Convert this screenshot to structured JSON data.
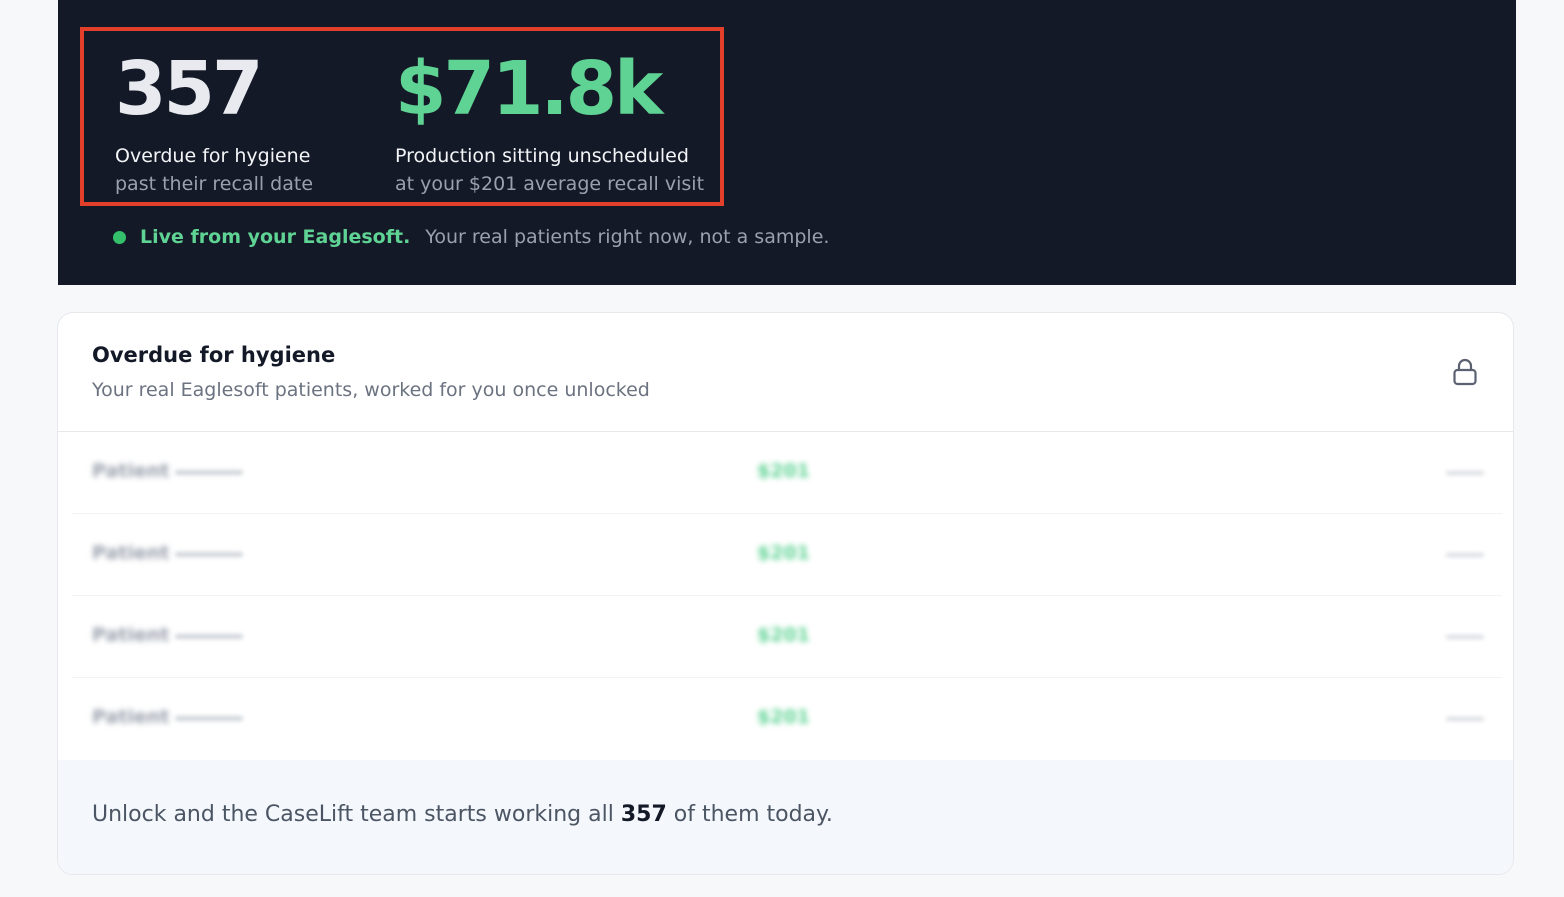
{
  "hero": {
    "stat1": {
      "value": "357",
      "label": "Overdue for hygiene",
      "sub": "past their recall date"
    },
    "stat2": {
      "value": "$71.8k",
      "label": "Production sitting unscheduled",
      "sub": "at your $201 average recall visit"
    },
    "live": {
      "strong": "Live from your Eaglesoft.",
      "rest": "Your real patients right now, not a sample."
    },
    "colors": {
      "background": "#141927",
      "accent_green": "#5fd394",
      "highlight_border": "#e2402b"
    }
  },
  "card": {
    "title": "Overdue for hygiene",
    "subtitle": "Your real Eaglesoft patients, worked for you once unlocked",
    "lock_icon": "lock-icon",
    "rows": [
      {
        "name": "Patient",
        "amount": "$201"
      },
      {
        "name": "Patient",
        "amount": "$201"
      },
      {
        "name": "Patient",
        "amount": "$201"
      },
      {
        "name": "Patient",
        "amount": "$201"
      }
    ],
    "footer": {
      "pre": "Unlock and the CaseLift team starts working all",
      "count": "357",
      "post": "of them today."
    }
  }
}
